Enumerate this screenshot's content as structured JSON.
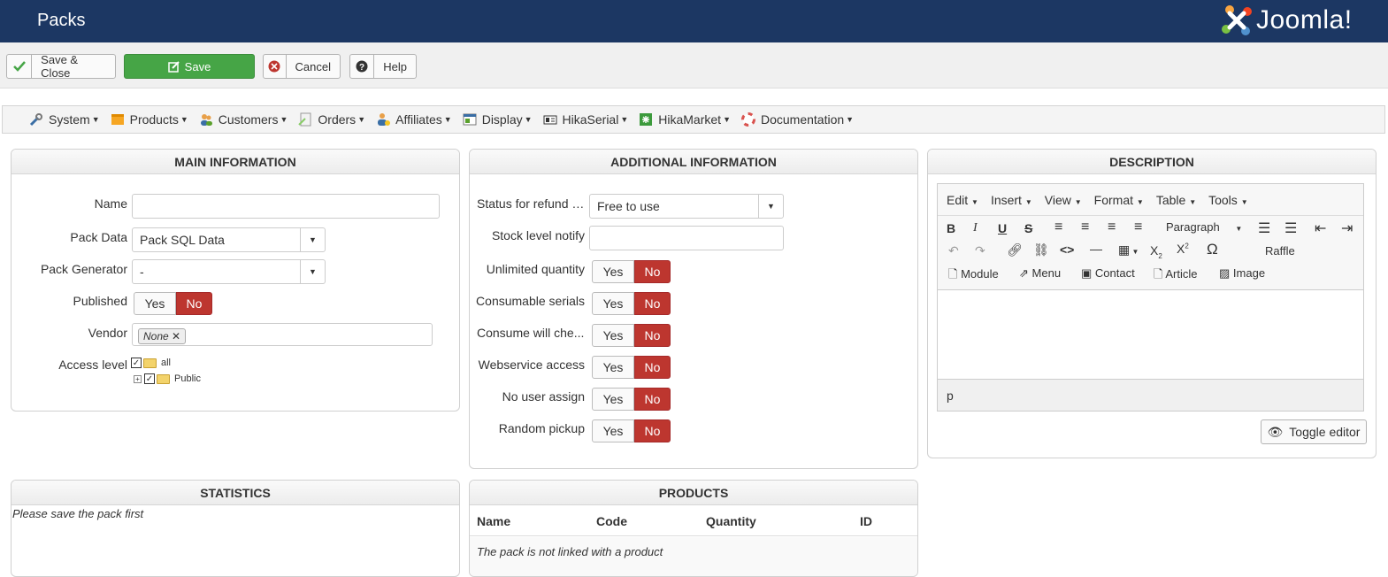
{
  "header": {
    "title": "Packs",
    "brand": "Joomla!"
  },
  "toolbar": {
    "save_close": "Save & Close",
    "save": "Save",
    "cancel": "Cancel",
    "help": "Help"
  },
  "menu": {
    "items": [
      "System",
      "Products",
      "Customers",
      "Orders",
      "Affiliates",
      "Display",
      "HikaSerial",
      "HikaMarket",
      "Documentation"
    ]
  },
  "main_info": {
    "heading": "MAIN INFORMATION",
    "name_label": "Name",
    "name_value": "",
    "pack_data_label": "Pack Data",
    "pack_data_value": "Pack SQL Data",
    "pack_generator_label": "Pack Generator",
    "pack_generator_value": "-",
    "published_label": "Published",
    "vendor_label": "Vendor",
    "vendor_tag": "None",
    "access_label": "Access level",
    "access_all": "all",
    "access_public": "Public"
  },
  "additional_info": {
    "heading": "ADDITIONAL INFORMATION",
    "status_label": "Status for refund s...",
    "status_value": "Free to use",
    "stock_label": "Stock level notify",
    "stock_value": "",
    "unlimited_label": "Unlimited quantity",
    "consumable_label": "Consumable serials",
    "consume_label": "Consume will che...",
    "webservice_label": "Webservice access",
    "nouser_label": "No user assign",
    "random_label": "Random pickup"
  },
  "yes_no": {
    "yes": "Yes",
    "no": "No"
  },
  "description": {
    "heading": "DESCRIPTION",
    "menus": [
      "Edit",
      "Insert",
      "View",
      "Format",
      "Table",
      "Tools"
    ],
    "paragraph": "Paragraph",
    "raffle": "Raffle",
    "plugins": [
      "Module",
      "Menu",
      "Contact",
      "Article",
      "Image"
    ],
    "status_path": "p",
    "toggle": "Toggle editor"
  },
  "statistics": {
    "heading": "STATISTICS",
    "message": "Please save the pack first"
  },
  "products": {
    "heading": "PRODUCTS",
    "columns": [
      "Name",
      "Code",
      "Quantity",
      "ID"
    ],
    "message": "The pack is not linked with a product"
  },
  "colors": {
    "header_bg": "#1c3763",
    "save_green": "#46a546",
    "no_red": "#bd362f"
  }
}
